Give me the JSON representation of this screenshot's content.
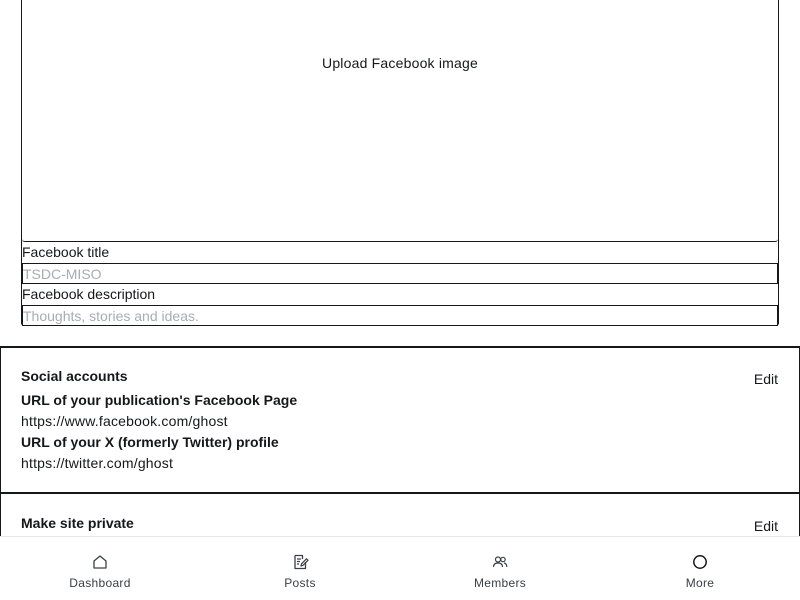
{
  "facebook_card": {
    "upload_label": "Upload Facebook image",
    "title_label": "Facebook title",
    "title_placeholder": "TSDC-MISO",
    "description_label": "Facebook description",
    "description_placeholder": "Thoughts, stories and ideas."
  },
  "social_accounts": {
    "title": "Social accounts",
    "edit_label": "Edit",
    "facebook_label": "URL of your publication's Facebook Page",
    "facebook_value": "https://www.facebook.com/ghost",
    "twitter_label": "URL of your X (formerly Twitter) profile",
    "twitter_value": "https://twitter.com/ghost"
  },
  "private_site": {
    "title": "Make site private",
    "edit_label": "Edit"
  },
  "bottom_nav": {
    "items": [
      {
        "label": "Dashboard",
        "icon": "home-icon"
      },
      {
        "label": "Posts",
        "icon": "posts-icon"
      },
      {
        "label": "Members",
        "icon": "members-icon"
      },
      {
        "label": "More",
        "icon": "more-icon"
      }
    ]
  }
}
